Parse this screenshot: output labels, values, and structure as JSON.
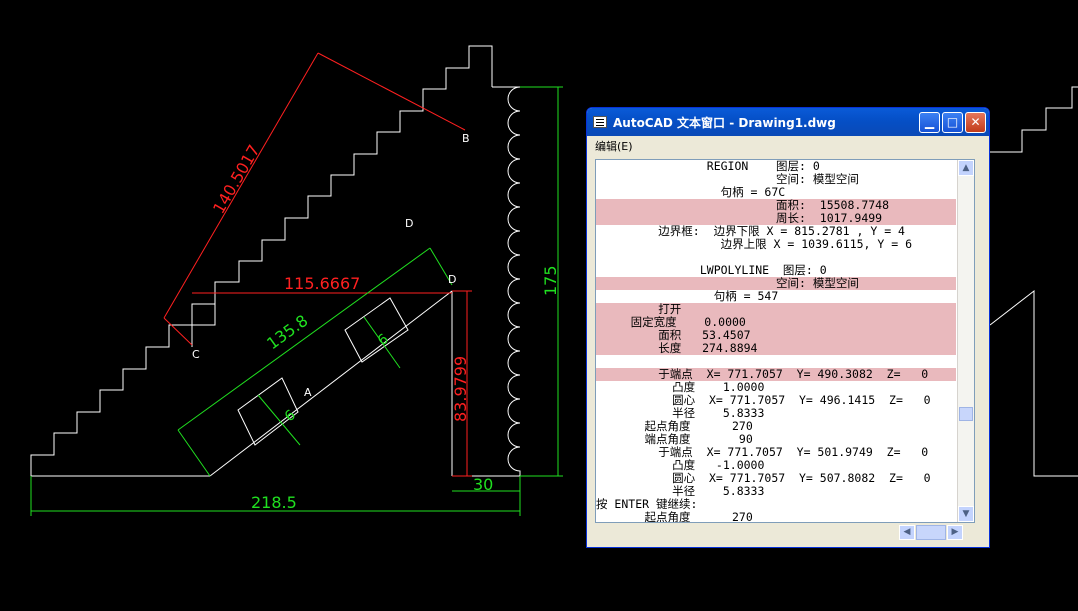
{
  "drawing": {
    "dim_diagonal": "140.5017",
    "dim_horizontal_top": "115.6667",
    "dim_incline": "135.8",
    "dim_vertical_red": "83.9799",
    "dim_bottom_total": "218.5",
    "dim_small_bottom": "30",
    "dim_right_height": "175",
    "dim_small_1": "6",
    "dim_small_2": "6",
    "label_a": "A",
    "label_b": "B",
    "label_c": "C",
    "label_d_upper": "D",
    "label_d_lower": "D",
    "colors": {
      "red": "#ff2020",
      "green": "#20e020",
      "white": "#ffffff"
    }
  },
  "text_window": {
    "title": "AutoCAD 文本窗口 - Drawing1.dwg",
    "menu_edit": "编辑(E)",
    "min_glyph": "▁",
    "max_glyph": "□",
    "close_glyph": "✕",
    "scroll_up": "▲",
    "scroll_down": "▼",
    "scroll_left": "◀",
    "scroll_right": "▶",
    "lines": [
      "                REGION    图层: 0",
      "                          空间: 模型空间",
      "                  句柄 = 67C",
      "                          面积:  15508.7748",
      "                          周长:  1017.9499",
      "         边界框:  边界下限 X = 815.2781 , Y = 4",
      "                  边界上限 X = 1039.6115, Y = 6",
      "",
      "               LWPOLYLINE  图层: 0",
      "                          空间: 模型空间",
      "                 句柄 = 547",
      "         打开",
      "     固定宽度    0.0000",
      "         面积   53.4507",
      "         长度   274.8894",
      "",
      "         于端点  X= 771.7057  Y= 490.3082  Z=   0",
      "           凸度    1.0000",
      "           圆心  X= 771.7057  Y= 496.1415  Z=   0",
      "           半径    5.8333",
      "       起点角度      270",
      "       端点角度       90",
      "         于端点  X= 771.7057  Y= 501.9749  Z=   0",
      "           凸度   -1.0000",
      "           圆心  X= 771.7057  Y= 507.8082  Z=   0",
      "           半径    5.8333",
      "按 ENTER 键继续:",
      "       起点角度      270"
    ]
  }
}
